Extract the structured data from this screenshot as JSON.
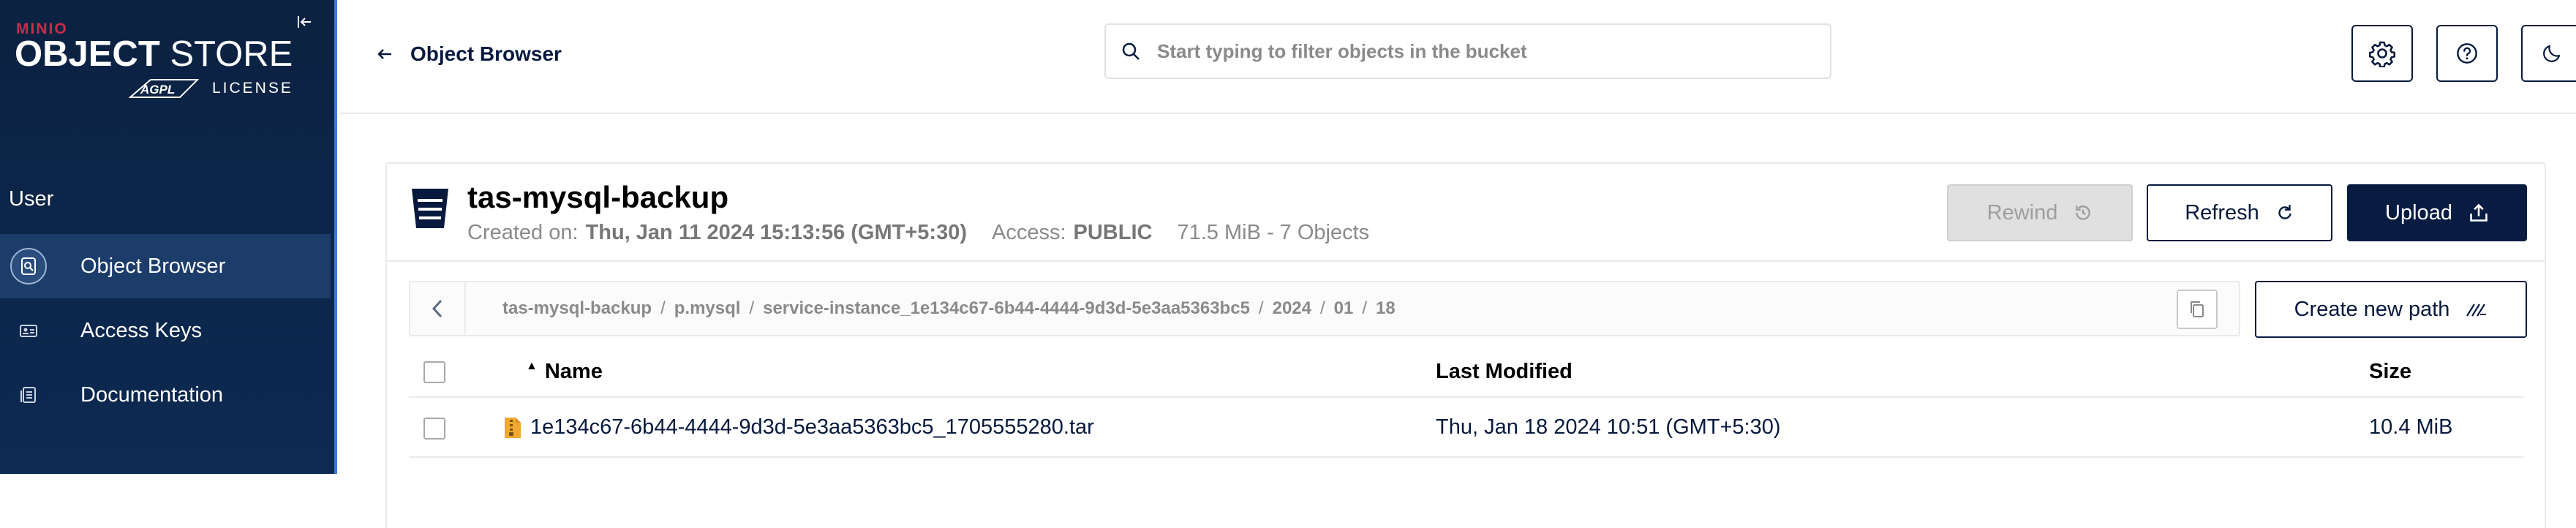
{
  "sidebar": {
    "logo": {
      "minio": "MINIO",
      "object": "OBJECT",
      "store": "STORE",
      "agpl": "AGPL",
      "license": "LICENSE"
    },
    "section": "User",
    "items": [
      {
        "label": "Object Browser",
        "icon": "object-browser-icon",
        "active": true
      },
      {
        "label": "Access Keys",
        "icon": "access-keys-icon",
        "active": false
      },
      {
        "label": "Documentation",
        "icon": "documentation-icon",
        "active": false
      }
    ]
  },
  "header": {
    "back_label": "Object Browser",
    "search_placeholder": "Start typing to filter objects in the bucket",
    "buttons": [
      "settings-icon",
      "help-icon",
      "dark-mode-icon"
    ]
  },
  "bucket": {
    "name": "tas-mysql-backup",
    "created_label": "Created on:",
    "created_value": "Thu, Jan 11 2024 15:13:56 (GMT+5:30)",
    "access_label": "Access:",
    "access_value": "PUBLIC",
    "size_summary": "71.5 MiB - 7 Objects"
  },
  "actions": {
    "rewind": "Rewind",
    "refresh": "Refresh",
    "upload": "Upload",
    "create_path": "Create new path"
  },
  "breadcrumb": [
    "tas-mysql-backup",
    "p.mysql",
    "service-instance_1e134c67-6b44-4444-9d3d-5e3aa5363bc5",
    "2024",
    "01",
    "18"
  ],
  "breadcrumb_separator": "/",
  "table": {
    "columns": {
      "name": "Name",
      "modified": "Last Modified",
      "size": "Size"
    },
    "sort_indicator": "▲",
    "rows": [
      {
        "name": "1e134c67-6b44-4444-9d3d-5e3aa5363bc5_1705555280.tar",
        "modified": "Thu, Jan 18 2024 10:51 (GMT+5:30)",
        "size": "10.4 MiB",
        "icon": "archive-file-icon"
      }
    ]
  },
  "colors": {
    "sidebar_bg": "#0b2141",
    "primary": "#081c42",
    "brand_red": "#c72e49",
    "file_icon": "#f0a830"
  }
}
